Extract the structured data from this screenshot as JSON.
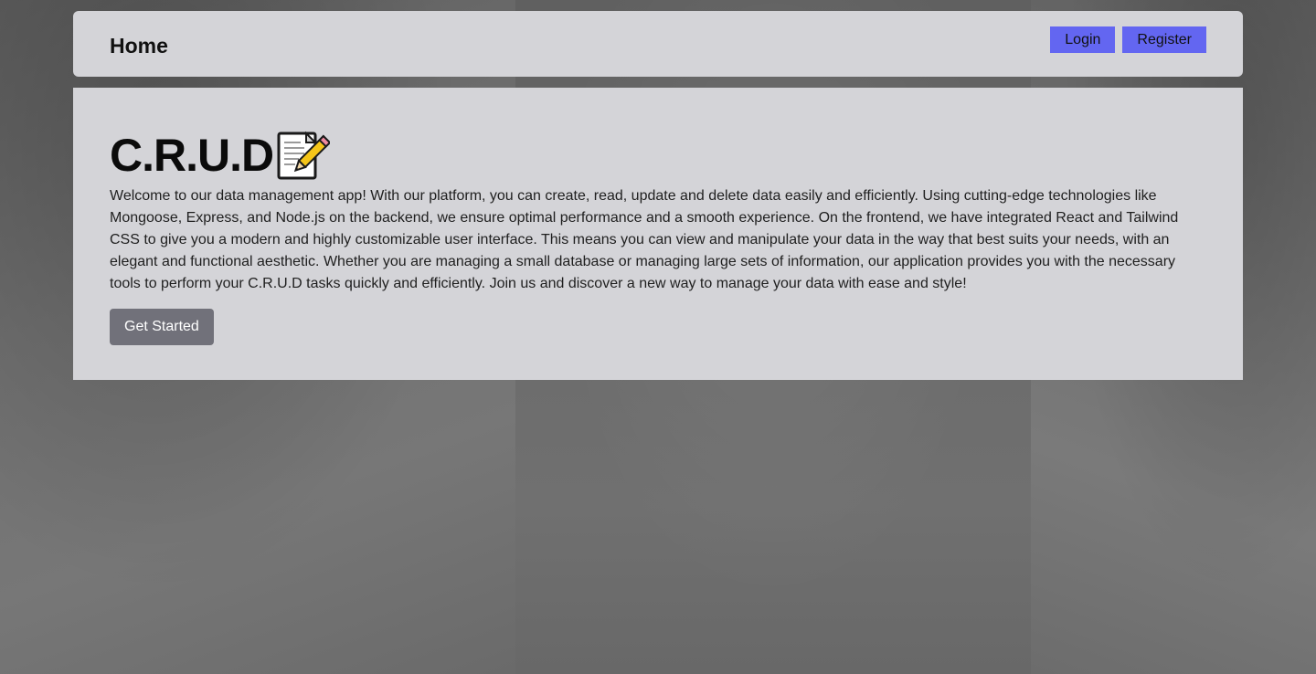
{
  "colors": {
    "panel_bg": "#d4d4d8",
    "nav_button_bg": "#6366f1",
    "cta_bg": "#71717a",
    "page_bg": "#6e6e6e"
  },
  "navbar": {
    "title": "Home",
    "login_label": "Login",
    "register_label": "Register"
  },
  "hero": {
    "title": "C.R.U.D",
    "icon": "memo-pencil-icon",
    "description": "Welcome to our data management app! With our platform, you can create, read, update and delete data easily and efficiently. Using cutting-edge technologies like Mongoose, Express, and Node.js on the backend, we ensure optimal performance and a smooth experience. On the frontend, we have integrated React and Tailwind CSS to give you a modern and highly customizable user interface. This means you can view and manipulate your data in the way that best suits your needs, with an elegant and functional aesthetic. Whether you are managing a small database or managing large sets of information, our application provides you with the necessary tools to perform your C.R.U.D tasks quickly and efficiently. Join us and discover a new way to manage your data with ease and style!",
    "cta_label": "Get Started"
  }
}
